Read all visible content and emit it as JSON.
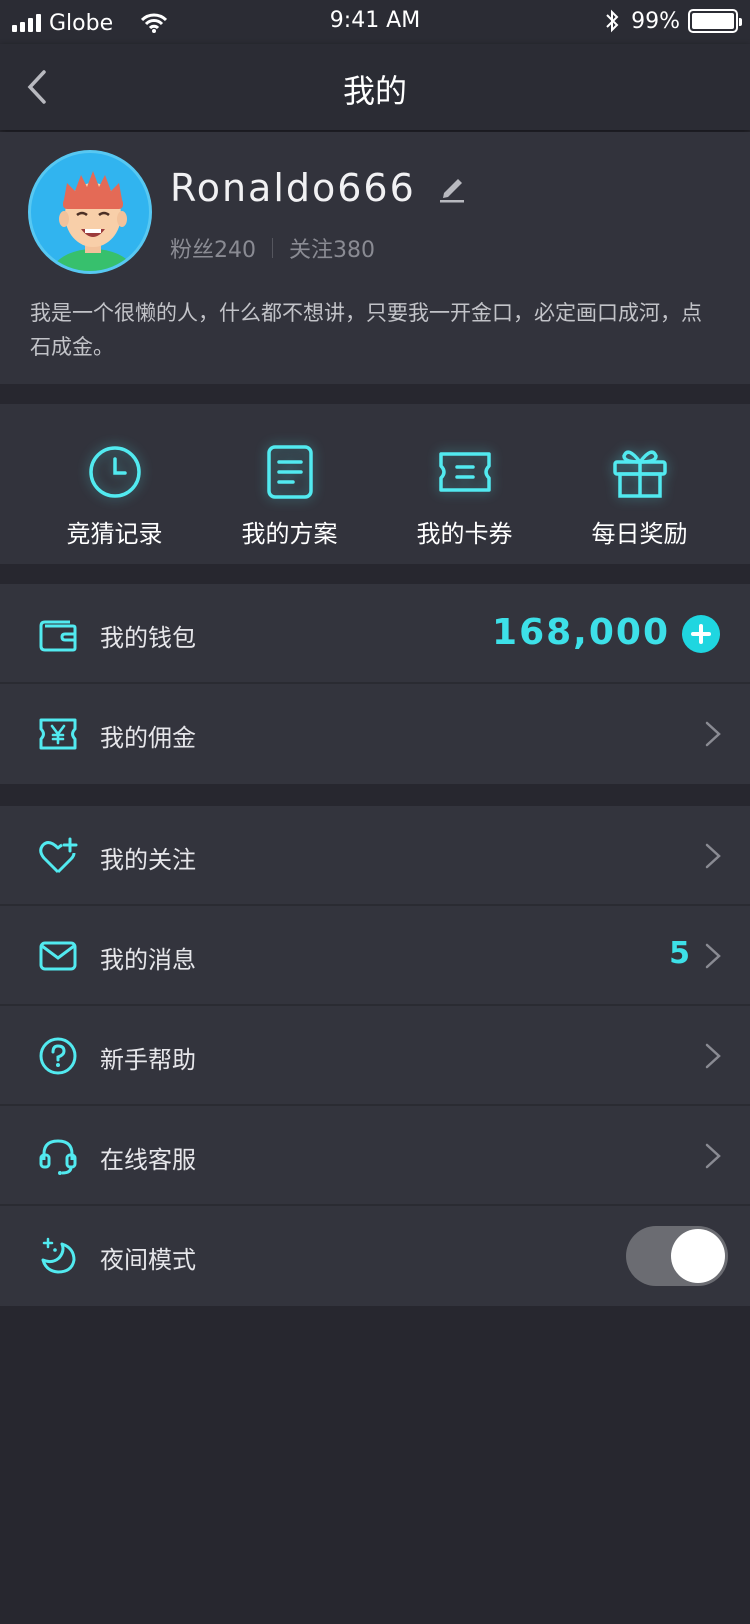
{
  "status_bar": {
    "carrier": "Globe",
    "time": "9:41 AM",
    "battery": "99%",
    "battery_level": 0.99
  },
  "nav": {
    "title": "我的"
  },
  "profile": {
    "username": "Ronaldo666",
    "fans_label": "粉丝240",
    "follow_label": "关注380",
    "bio": "我是一个很懒的人，什么都不想讲，只要我一开金口，必定画口成河，点石成金。"
  },
  "quick_actions": [
    {
      "label": "竞猜记录",
      "icon": "clock-icon"
    },
    {
      "label": "我的方案",
      "icon": "document-icon"
    },
    {
      "label": "我的卡券",
      "icon": "ticket-icon"
    },
    {
      "label": "每日奖励",
      "icon": "gift-icon"
    }
  ],
  "wallet_section": {
    "wallet": {
      "label": "我的钱包",
      "amount": "168,000",
      "icon": "wallet-icon"
    },
    "commission": {
      "label": "我的佣金",
      "icon": "yen-ticket-icon"
    }
  },
  "menu": [
    {
      "label": "我的关注",
      "icon": "heart-plus-icon"
    },
    {
      "label": "我的消息",
      "icon": "mail-icon",
      "badge": "5"
    },
    {
      "label": "新手帮助",
      "icon": "help-icon"
    },
    {
      "label": "在线客服",
      "icon": "headset-icon"
    },
    {
      "label": "夜间模式",
      "icon": "moon-icon",
      "toggle_on": true
    }
  ],
  "colors": {
    "accent": "#3de0e8",
    "background": "#27272f",
    "card": "#33343d"
  }
}
